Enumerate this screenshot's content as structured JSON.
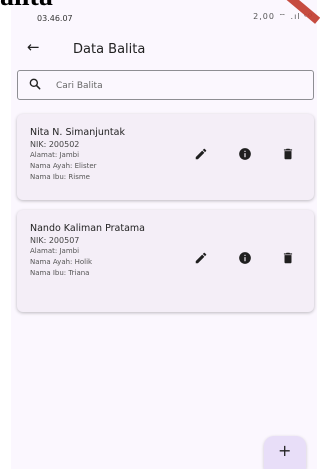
{
  "overlay": {
    "title": "alita"
  },
  "status_bar": {
    "time": "03.46.07",
    "icons": "2,00 ⌔ .ıl ᶜᴼ"
  },
  "app_bar": {
    "back_icon": "arrow-left-icon",
    "title": "Data Balita"
  },
  "search": {
    "placeholder": "Cari Balita",
    "value": ""
  },
  "balita": [
    {
      "name": "Nita N. Simanjuntak",
      "nik": "NIK: 200502",
      "alamat": "Alamat: Jambi",
      "ayah": "Nama Ayah: Elister",
      "ibu": "Nama Ibu: Risme"
    },
    {
      "name": "Nando Kaliman Pratama",
      "nik": "NIK: 200507",
      "alamat": "Alamat: Jambi",
      "ayah": "Nama Ayah: Holik",
      "ibu": "Nama Ibu: Triana"
    }
  ],
  "actions": {
    "edit_icon": "pencil-icon",
    "info_icon": "info-icon",
    "delete_icon": "trash-icon"
  },
  "fab": {
    "label": "+"
  },
  "colors": {
    "background": "#fbf7fe",
    "card": "#f4eef7",
    "fab": "#e8def8",
    "icon": "#1f1f1f"
  }
}
